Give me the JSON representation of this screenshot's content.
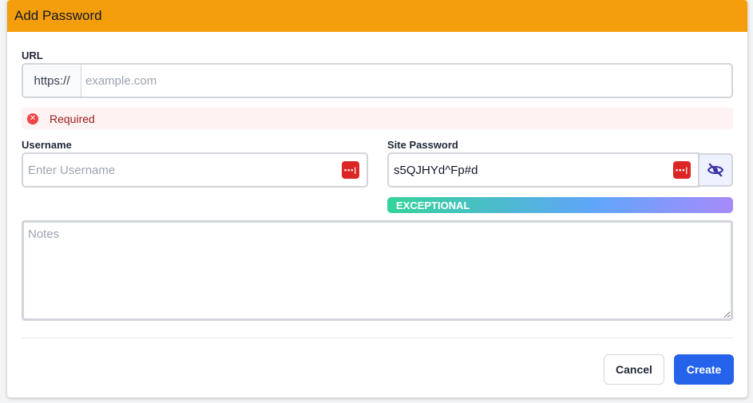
{
  "dialog": {
    "title": "Add Password"
  },
  "url": {
    "label": "URL",
    "prefix": "https://",
    "placeholder": "example.com",
    "value": ""
  },
  "error": {
    "text": "Required"
  },
  "username": {
    "label": "Username",
    "placeholder": "Enter Username",
    "value": ""
  },
  "password": {
    "label": "Site Password",
    "value": "s5QJHYd^Fp#d",
    "strength": "EXCEPTIONAL"
  },
  "notes": {
    "placeholder": "Notes",
    "value": ""
  },
  "buttons": {
    "cancel": "Cancel",
    "create": "Create"
  },
  "icons": {
    "error": "error-circle-icon",
    "generate": "password-dots-icon",
    "visibility": "eye-slash-icon"
  },
  "colors": {
    "header": "#f59e0b",
    "primary": "#2563eb",
    "error": "#ef4444",
    "generate_icon": "#dc2626"
  }
}
